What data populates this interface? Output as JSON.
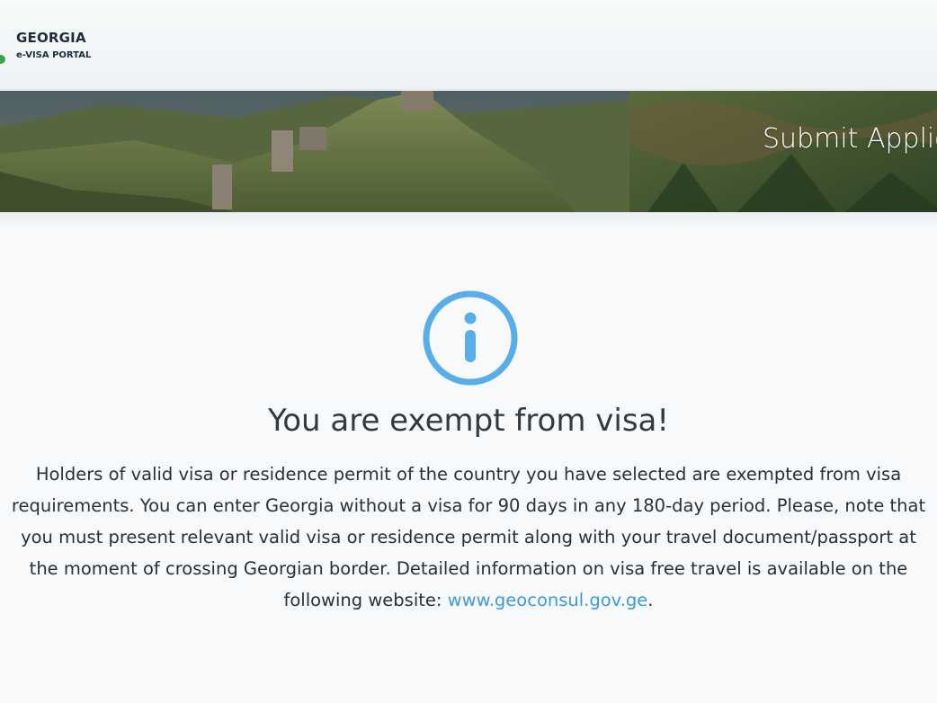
{
  "header": {
    "logo_title": "GEORGIA",
    "logo_subtitle": "e-VISA PORTAL"
  },
  "banner": {
    "title": "Submit Applic"
  },
  "notice": {
    "icon": "info-circle-icon",
    "icon_color": "#5aaee8",
    "headline": "You are exempt from visa!",
    "lines": [
      "Holders of valid visa or residence permit of the country you have selected are exempted from visa",
      "requirements. You can enter Georgia without a visa for 90 days in any 180-day period. Please, note that",
      "you must present relevant valid visa or residence permit along with your travel document/passport at",
      "the moment of crossing Georgian border. Detailed information on visa free travel is available on the"
    ],
    "last_line_prefix": "following website: ",
    "link_text": "www.geoconsul.gov.ge",
    "last_line_suffix": ".",
    "link_color": "#3d9ad9"
  }
}
